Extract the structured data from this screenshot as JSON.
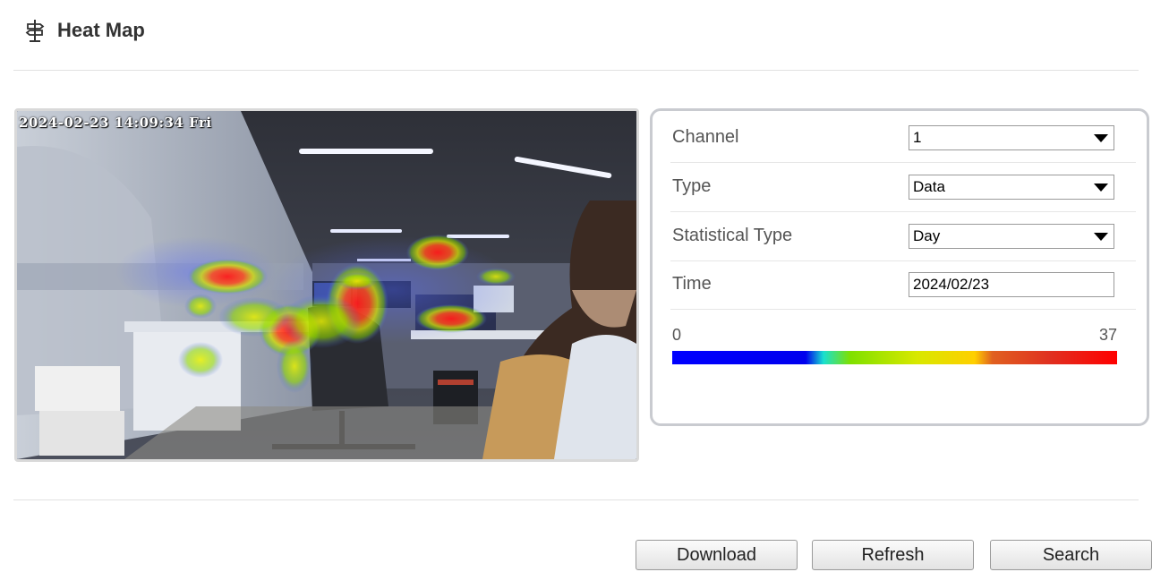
{
  "header": {
    "title": "Heat Map",
    "icon": "signpost-icon"
  },
  "video": {
    "osd_text": "2024-02-23 14:09:34 Fri"
  },
  "form": {
    "channel": {
      "label": "Channel",
      "value": "1"
    },
    "type": {
      "label": "Type",
      "value": "Data"
    },
    "statistical_type": {
      "label": "Statistical Type",
      "value": "Day"
    },
    "time": {
      "label": "Time",
      "value": "2024/02/23"
    }
  },
  "scale": {
    "min": "0",
    "max": "37"
  },
  "buttons": {
    "download": "Download",
    "refresh": "Refresh",
    "search": "Search"
  }
}
